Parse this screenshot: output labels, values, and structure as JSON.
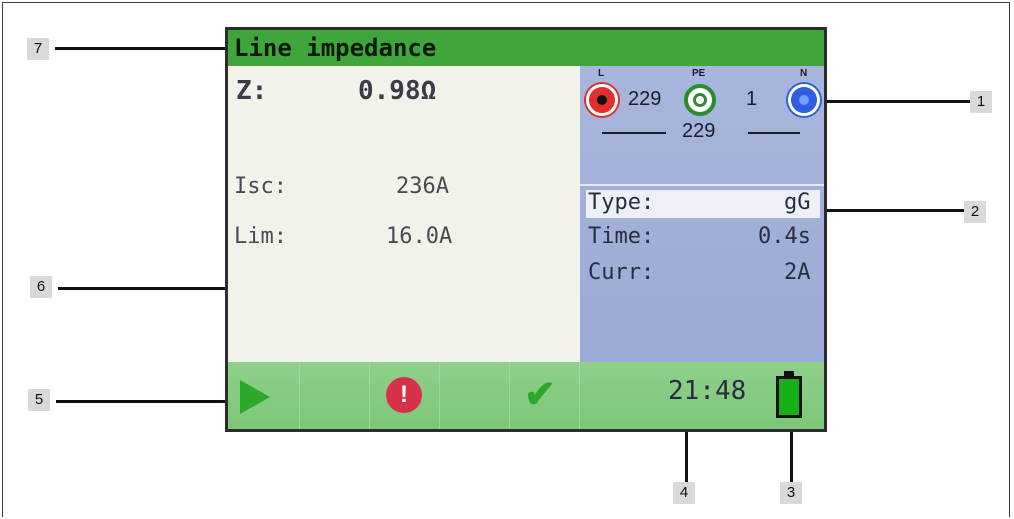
{
  "callouts": [
    "1",
    "2",
    "3",
    "4",
    "5",
    "6",
    "7"
  ],
  "screen": {
    "title": "Line impedance",
    "result": {
      "z_label": "Z:",
      "z_value": "0.98Ω"
    },
    "isc": {
      "label": "Isc:",
      "value": "236A"
    },
    "lim": {
      "label": "Lim:",
      "value": "16.0A"
    },
    "terminals": {
      "l_label": "L",
      "pe_label": "PE",
      "n_label": "N",
      "l_pe": "229",
      "pe_n": "1",
      "l_n": "229"
    },
    "params": [
      {
        "label": "Type:",
        "value": "gG"
      },
      {
        "label": "Time:",
        "value": "0.4s"
      },
      {
        "label": "Curr:",
        "value": "2A"
      }
    ],
    "time": "21:48"
  },
  "colors": {
    "title_green": "#3ea63a",
    "bar_green": "#7cc677",
    "panel_blue": "#a8b6dc"
  }
}
